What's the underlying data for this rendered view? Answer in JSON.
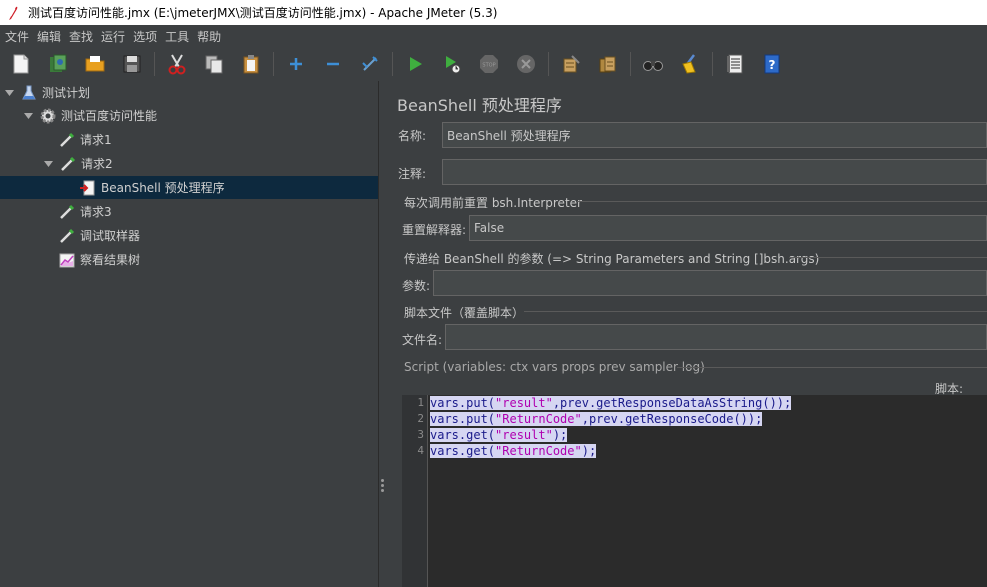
{
  "window": {
    "title": "测试百度访问性能.jmx (E:\\jmeterJMX\\测试百度访问性能.jmx) - Apache JMeter (5.3)"
  },
  "menu": [
    "文件",
    "编辑",
    "查找",
    "运行",
    "选项",
    "工具",
    "帮助"
  ],
  "tree": {
    "items": [
      {
        "label": "测试计划",
        "icon": "flask-icon"
      },
      {
        "label": "测试百度访问性能",
        "icon": "gear-icon"
      },
      {
        "label": "请求1",
        "icon": "pipette-icon"
      },
      {
        "label": "请求2",
        "icon": "pipette-icon"
      },
      {
        "label": "BeanShell 预处理程序",
        "icon": "preprocessor-icon"
      },
      {
        "label": "请求3",
        "icon": "pipette-icon"
      },
      {
        "label": "调试取样器",
        "icon": "pipette-icon"
      },
      {
        "label": "察看结果树",
        "icon": "chart-icon"
      }
    ]
  },
  "panel": {
    "title": "BeanShell 预处理程序",
    "name_label": "名称:",
    "name_value": "BeanShell 预处理程序",
    "comment_label": "注释:",
    "comment_value": "",
    "reset_group": "每次调用前重置 bsh.Interpreter",
    "reset_label": "重置解释器:",
    "reset_value": "False",
    "params_group": "传递给 BeanShell 的参数 (=> String Parameters and String []bsh.args)",
    "params_label": "参数:",
    "params_value": "",
    "file_group": "脚本文件（覆盖脚本）",
    "file_label": "文件名:",
    "file_value": "",
    "script_hint": "Script (variables: ctx vars props prev sampler log)",
    "script_label": "脚本:"
  },
  "script": {
    "line_numbers": [
      "1",
      "2",
      "3",
      "4"
    ],
    "lines": [
      {
        "pre": "vars.put(",
        "str": "\"result\"",
        "post": ",prev.getResponseDataAsString());"
      },
      {
        "pre": "vars.put(",
        "str": "\"ReturnCode\"",
        "post": ",prev.getResponseCode());"
      },
      {
        "pre": "vars.get(",
        "str": "\"result\"",
        "post": ");"
      },
      {
        "pre": "vars.get(",
        "str": "\"ReturnCode\"",
        "post": ");"
      }
    ]
  },
  "colors": {
    "background": "#3c3f41",
    "selection": "#0d293e",
    "editor_selection": "#d6d6f2"
  }
}
